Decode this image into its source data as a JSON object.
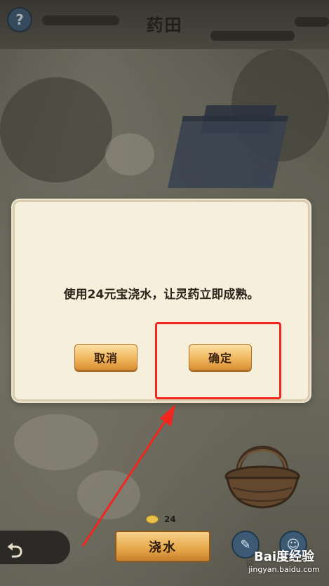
{
  "header": {
    "title": "药田",
    "help_icon": "?"
  },
  "dialog": {
    "message": "使用24元宝浇水，让灵药立即成熟。",
    "cancel_label": "取消",
    "confirm_label": "确定"
  },
  "bottom": {
    "ingot_count": "24",
    "water_label": "浇水",
    "record_label": "记"
  },
  "watermark": {
    "logo": "Bai度经验",
    "url": "jingyan.baidu.com"
  },
  "colors": {
    "highlight": "#f0261f",
    "button_gold": "#f1b65e",
    "dialog_bg": "#f6efdc"
  },
  "icons": {
    "help": "question-icon",
    "back": "back-arrow-icon",
    "ingot": "ingot-icon",
    "basket": "basket-icon",
    "scroll": "scroll-icon",
    "friends": "friends-icon"
  }
}
